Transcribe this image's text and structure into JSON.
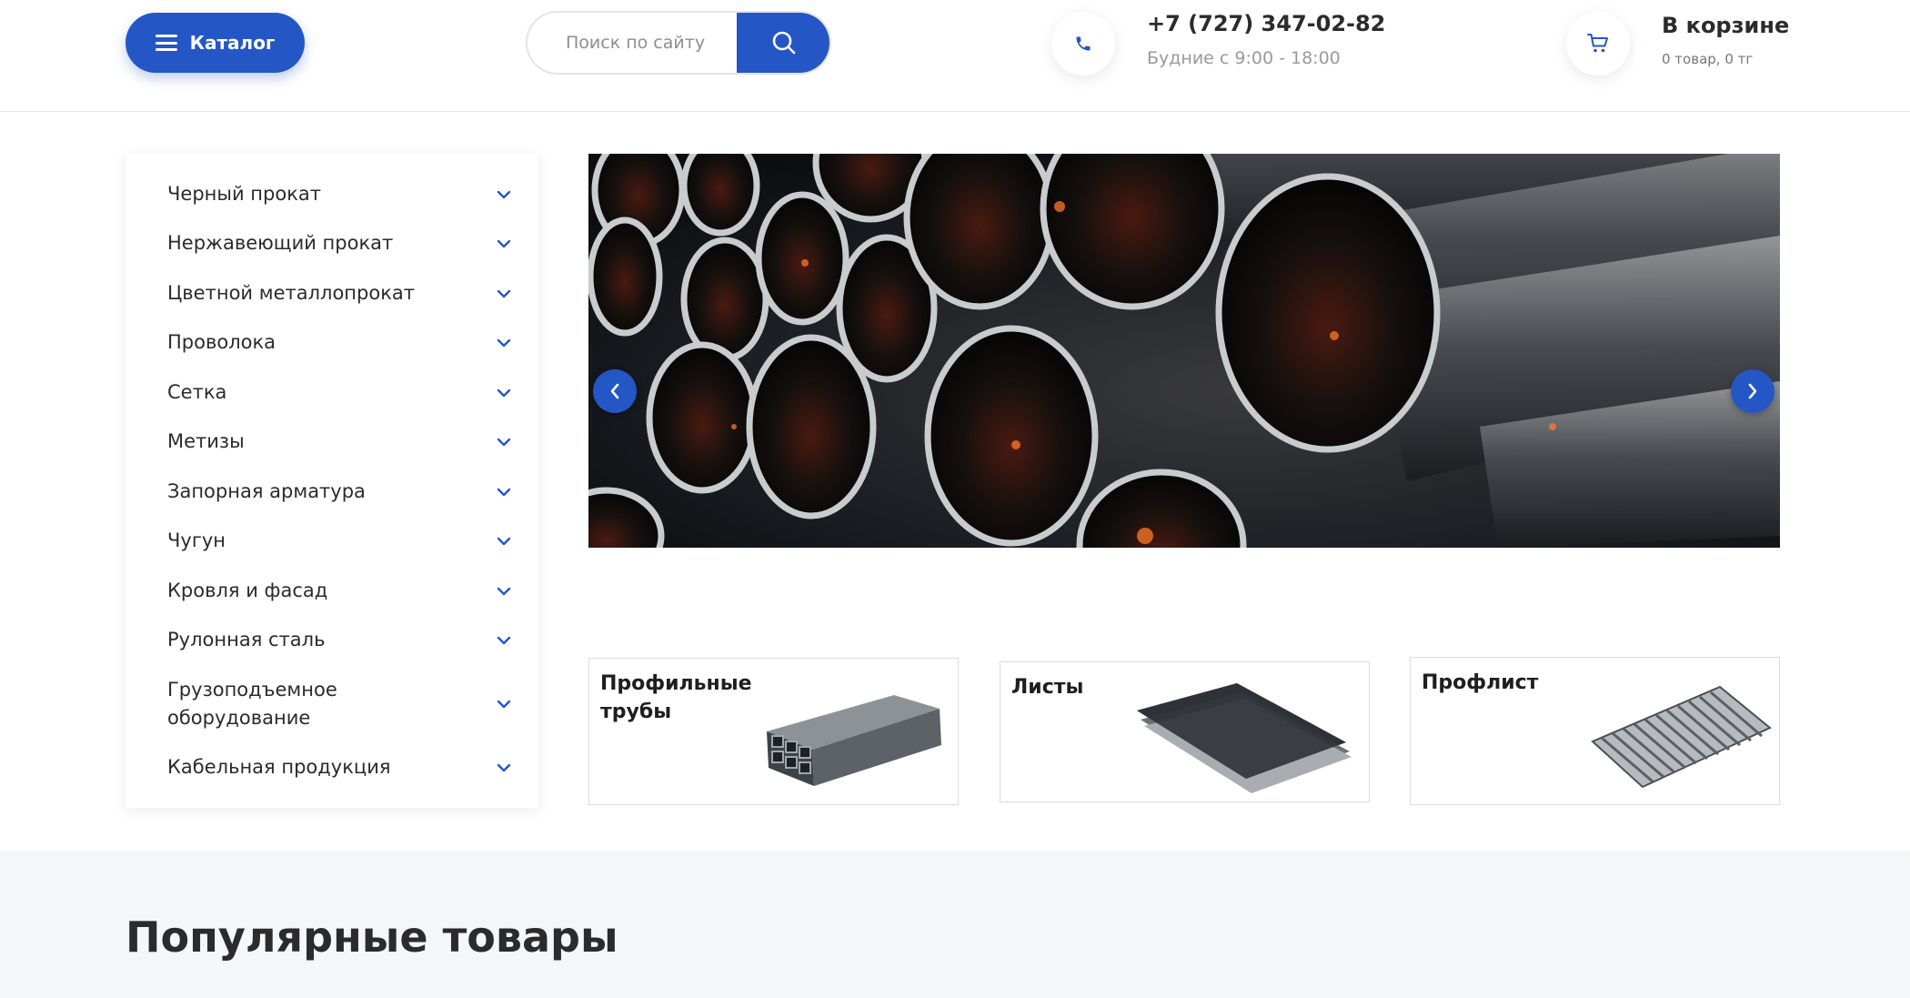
{
  "header": {
    "catalog_label": "Каталог",
    "search_placeholder": "Поиск по сайту",
    "phone": "+7 (727) 347-02-82",
    "hours": "Будние с 9:00 - 18:00",
    "cart_title": "В корзине",
    "cart_summary": "0 товар, 0 тг"
  },
  "sidebar": {
    "items": [
      {
        "label": "Черный прокат"
      },
      {
        "label": "Нержавеющий прокат"
      },
      {
        "label": "Цветной металлопрокат"
      },
      {
        "label": "Проволока"
      },
      {
        "label": "Сетка"
      },
      {
        "label": "Метизы"
      },
      {
        "label": "Запорная арматура"
      },
      {
        "label": "Чугун"
      },
      {
        "label": "Кровля и фасад"
      },
      {
        "label": "Рулонная сталь"
      },
      {
        "label": "Грузоподъемное оборудование"
      },
      {
        "label": "Кабельная продукция"
      }
    ]
  },
  "categories": [
    {
      "title": "Профильные трубы",
      "image": "profile-pipes-image"
    },
    {
      "title": "Листы",
      "image": "metal-sheets-image"
    },
    {
      "title": "Профлист",
      "image": "corrugated-sheets-image"
    }
  ],
  "popular": {
    "title": "Популярные товары"
  },
  "icons": {
    "catalog": "hamburger-menu-icon",
    "search": "search-icon",
    "phone": "phone-icon",
    "cart": "cart-icon",
    "sidebar_chevron": "chevron-down-icon",
    "slider_prev": "chevron-left-icon",
    "slider_next": "chevron-right-icon"
  },
  "colors": {
    "accent": "#2456c6",
    "text": "#2b2b2b",
    "muted": "#9a9a9a",
    "section_bg": "#f5f6f8"
  }
}
